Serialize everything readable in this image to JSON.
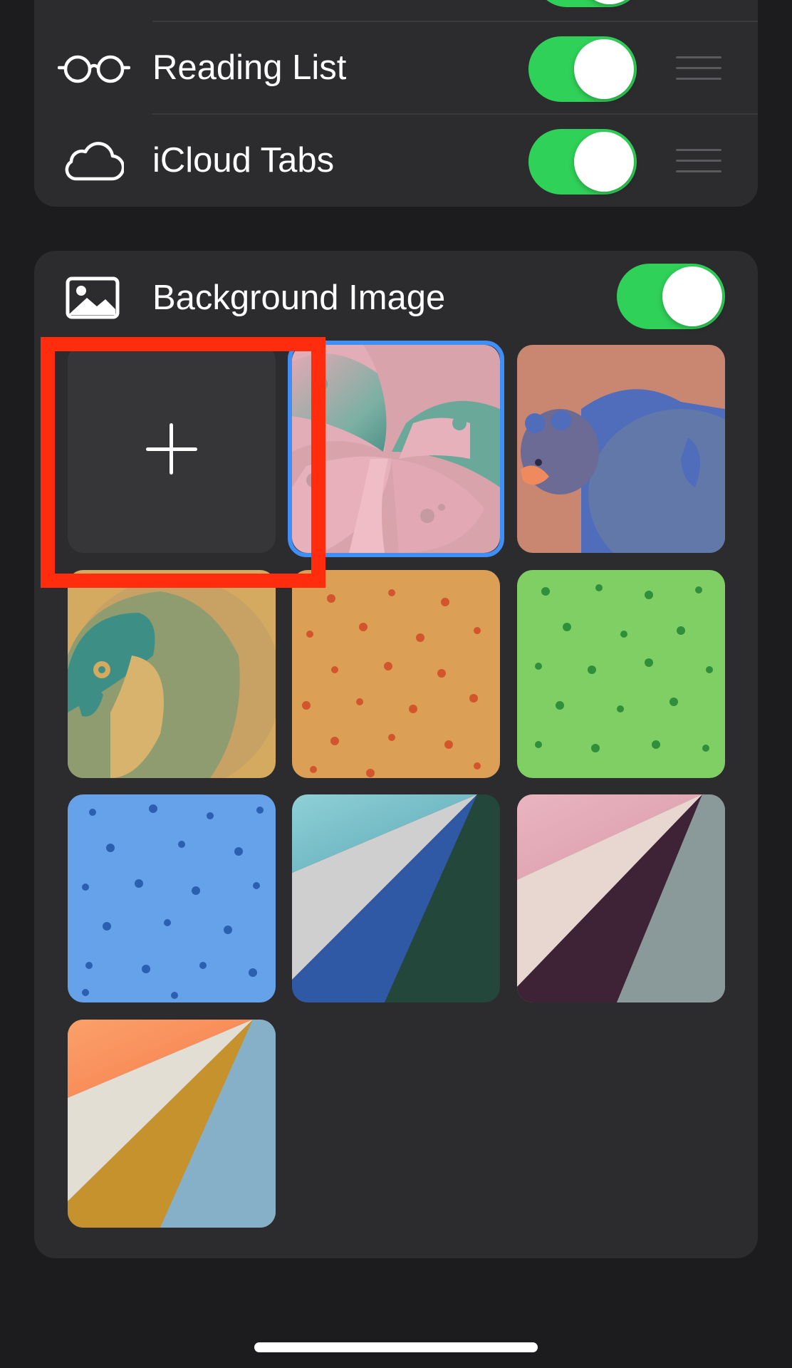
{
  "list": {
    "items": [
      {
        "label": "Reading List",
        "enabled": true,
        "icon": "glasses-icon"
      },
      {
        "label": "iCloud Tabs",
        "enabled": true,
        "icon": "cloud-icon"
      }
    ]
  },
  "background_image": {
    "label": "Background Image",
    "enabled": true,
    "icon": "photo-icon",
    "add_button": "add-image",
    "selected_index": 1,
    "wallpapers": [
      "butterfly",
      "bear",
      "parrot",
      "food-pattern",
      "dinosaur-pattern",
      "ocean-pattern",
      "folded-blue-green",
      "folded-pink-plum",
      "folded-orange-gold"
    ]
  },
  "colors": {
    "accent_toggle": "#30d158",
    "selection": "#3f8ff7",
    "highlight": "#ff2d0e"
  }
}
